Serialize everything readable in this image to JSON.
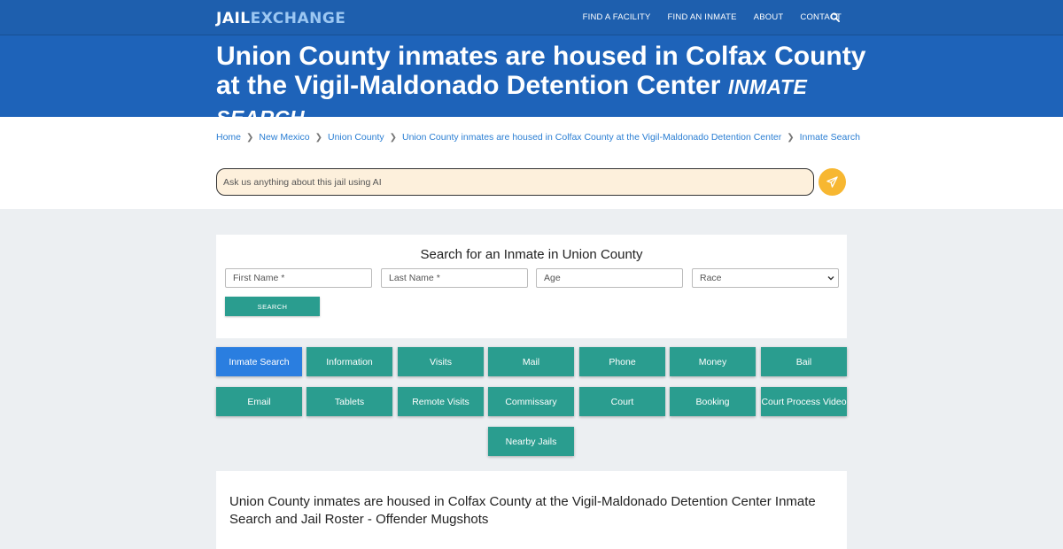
{
  "logo": {
    "part1": "JAIL",
    "part2": "EXCHANGE"
  },
  "nav": {
    "links": [
      "FIND A FACILITY",
      "FIND AN INMATE",
      "ABOUT",
      "CONTACT"
    ],
    "search_icon": "search-icon"
  },
  "hero": {
    "title": "Union County inmates are housed in Colfax County at the Vigil-Maldonado Detention Center",
    "subtitle": "INMATE SEARCH"
  },
  "breadcrumb": [
    "Home",
    "New Mexico",
    "Union County",
    "Union County inmates are housed in Colfax County at the Vigil-Maldonado Detention Center",
    "Inmate Search"
  ],
  "ai": {
    "placeholder": "Ask us anything about this jail using AI",
    "send_icon": "paper-plane-icon"
  },
  "search": {
    "title": "Search for an Inmate in Union County",
    "first_name": "First Name *",
    "last_name": "Last Name *",
    "age": "Age",
    "race": "Race",
    "button": "SEARCH"
  },
  "tiles": [
    "Inmate Search",
    "Information",
    "Visits",
    "Mail",
    "Phone",
    "Money",
    "Bail",
    "Email",
    "Tablets",
    "Remote Visits",
    "Commissary",
    "Court",
    "Booking",
    "Court Process Video",
    "Nearby Jails"
  ],
  "article": {
    "title": "Union County inmates are housed in Colfax County at the Vigil-Maldonado Detention Center Inmate Search and Jail Roster - Offender Mugshots"
  },
  "colors": {
    "nav": "#1e5fae",
    "hero": "#1e63b9",
    "tile": "#2a9d8f",
    "active_tile": "#2a7ee0",
    "send_button": "#f7b731",
    "link": "#2a7ed3"
  }
}
